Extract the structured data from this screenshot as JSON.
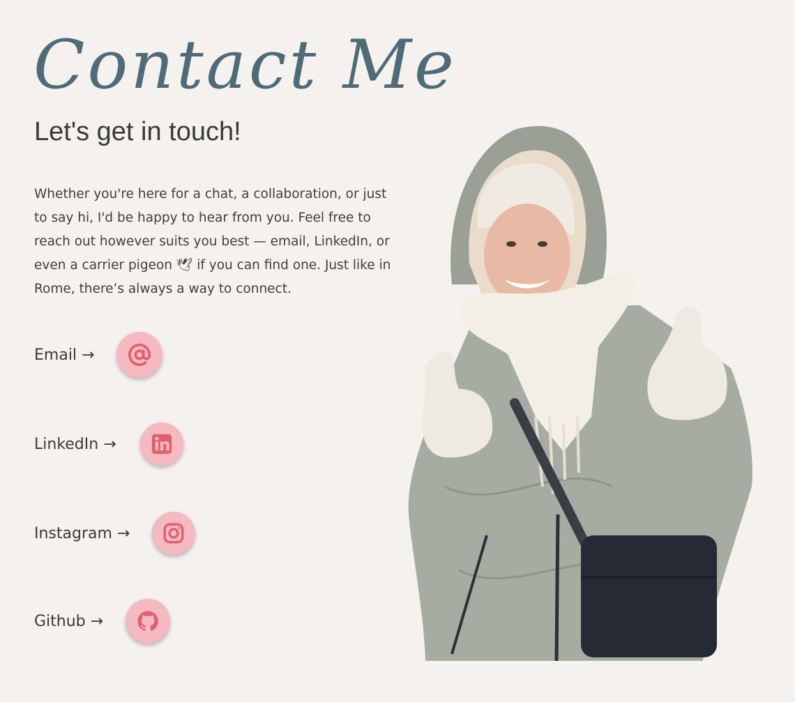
{
  "header": {
    "title": "Contact Me",
    "subtitle": "Let's get in touch!"
  },
  "intro": {
    "text": "Whether you're here for a chat, a collaboration, or just to say hi, I'd be happy to hear from you. Feel free to reach out however suits you best — email, LinkedIn, or even a carrier pigeon 🕊 if you can find one. Just like in Rome, there’s always a way to connect."
  },
  "contacts": [
    {
      "label": "Email →",
      "icon": "at-sign-icon"
    },
    {
      "label": "LinkedIn →",
      "icon": "linkedin-icon"
    },
    {
      "label": "Instagram →",
      "icon": "instagram-icon"
    },
    {
      "label": "Github →",
      "icon": "github-icon"
    }
  ],
  "colors": {
    "background": "#f4f1ee",
    "title": "#4e6b77",
    "icon_bg": "#f4b9c1",
    "icon_fg": "#e0606f"
  }
}
